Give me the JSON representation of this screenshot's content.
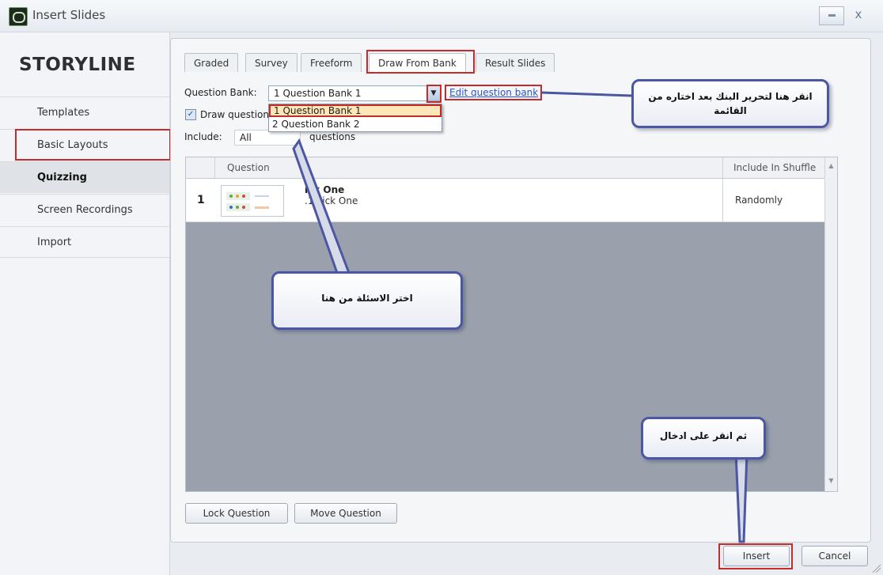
{
  "window": {
    "title": "Insert Slides",
    "minimize_icon": "minimize-icon",
    "close_label": "x"
  },
  "sidebar": {
    "brand": "STORYLINE",
    "items": [
      {
        "label": "Templates"
      },
      {
        "label": "Basic Layouts"
      },
      {
        "label": "Quizzing",
        "active": true
      },
      {
        "label": "Screen Recordings"
      },
      {
        "label": "Import"
      }
    ]
  },
  "tabs": [
    {
      "label": "Graded"
    },
    {
      "label": "Survey"
    },
    {
      "label": "Freeform"
    },
    {
      "label": "Draw From Bank",
      "active": true
    },
    {
      "label": "Result Slides"
    }
  ],
  "form": {
    "question_bank_label": "Question Bank:",
    "question_bank_value": "1 Question Bank 1",
    "edit_link": "Edit question bank",
    "draw_label": "Draw question",
    "draw_checked": true,
    "include_label": "Include:",
    "include_value": "All",
    "include_suffix": "questions",
    "dropdown_options": [
      "1 Question Bank 1",
      "2 Question Bank 2"
    ]
  },
  "table": {
    "columns": [
      "Question",
      "Include In Shuffle"
    ],
    "rows": [
      {
        "num": "1",
        "title": "ick One",
        "subtitle": ".1 Pick One",
        "shuffle": "Randomly"
      }
    ]
  },
  "buttons": {
    "lock": "Lock Question",
    "move": "Move Question",
    "insert": "Insert",
    "cancel": "Cancel"
  },
  "callouts": {
    "edit_bank": "انقر هنا لتحرير البنك بعد اختاره من القائمة",
    "choose_questions": "اختر الاسئلة من هنا",
    "click_insert": "ثم انقر على ادخال"
  },
  "colors": {
    "highlight": "#c42b2b",
    "callout_border": "#4b57a3",
    "link": "#2a56c6"
  }
}
